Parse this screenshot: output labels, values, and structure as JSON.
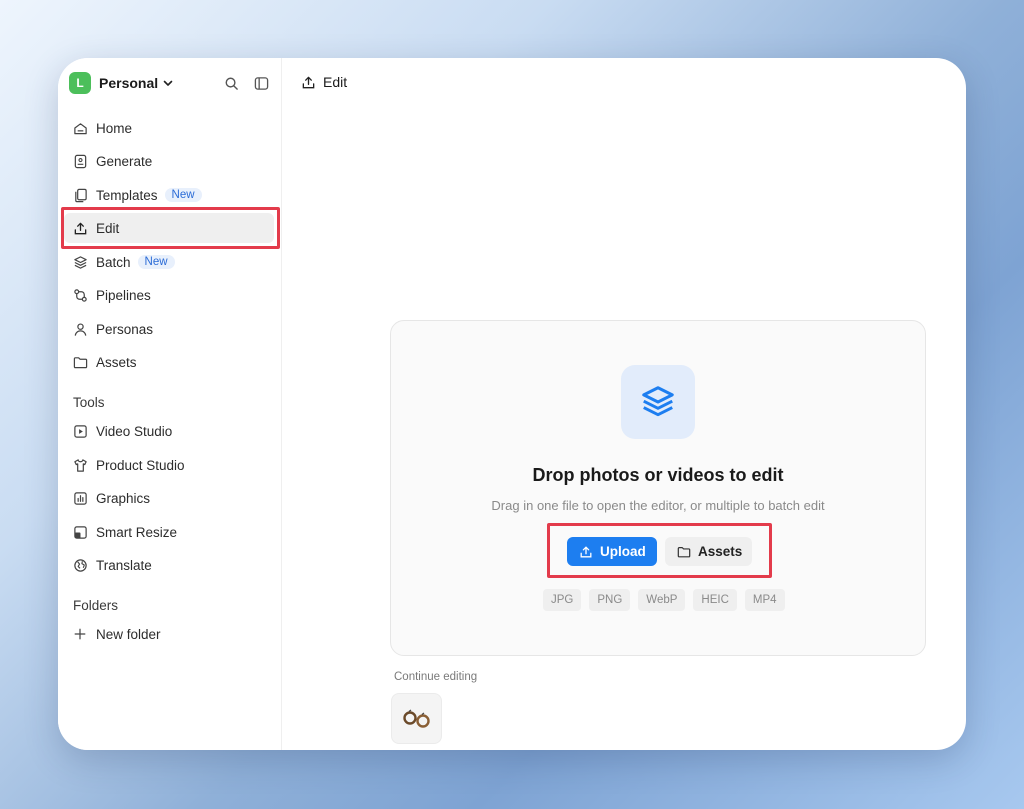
{
  "workspace": {
    "initial": "L",
    "name": "Personal"
  },
  "nav": {
    "home": "Home",
    "generate": "Generate",
    "templates": "Templates",
    "templates_badge": "New",
    "edit": "Edit",
    "batch": "Batch",
    "batch_badge": "New",
    "pipelines": "Pipelines",
    "personas": "Personas",
    "assets": "Assets"
  },
  "tools": {
    "label": "Tools",
    "video_studio": "Video Studio",
    "product_studio": "Product Studio",
    "graphics": "Graphics",
    "smart_resize": "Smart Resize",
    "translate": "Translate"
  },
  "folders": {
    "label": "Folders",
    "new_folder": "New folder"
  },
  "header": {
    "title": "Edit"
  },
  "dropzone": {
    "title": "Drop photos or videos to edit",
    "subtitle": "Drag in one file to open the editor, or multiple to batch edit",
    "upload_label": "Upload",
    "assets_label": "Assets",
    "types": [
      "JPG",
      "PNG",
      "WebP",
      "HEIC",
      "MP4"
    ]
  },
  "continue": {
    "label": "Continue editing"
  },
  "colors": {
    "accent": "#1d7ef0",
    "highlight": "#e33b4b",
    "avatar": "#4cbf5b"
  }
}
